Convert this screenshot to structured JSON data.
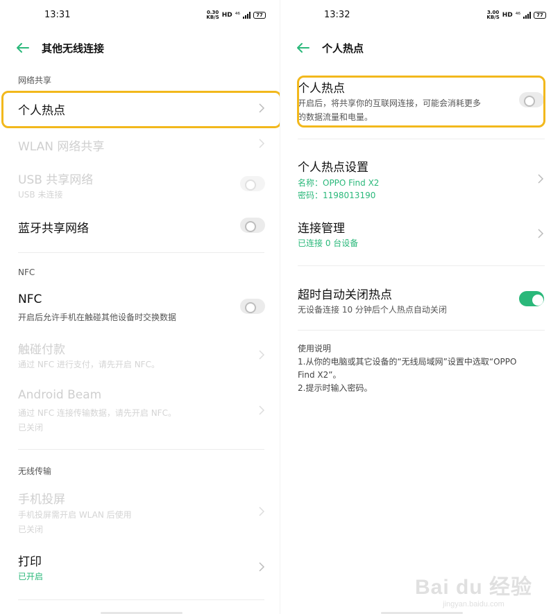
{
  "left": {
    "status": {
      "time": "13:31",
      "speed_value": "0.30",
      "speed_unit": "KB/S",
      "hd": "HD",
      "net": "⁴⁶",
      "battery": "77"
    },
    "header": {
      "title": "其他无线连接"
    },
    "sections": {
      "network_share": "网络共享",
      "nfc": "NFC",
      "wireless_transfer": "无线传输"
    },
    "items": {
      "hotspot": "个人热点",
      "wlan_share": "WLAN 网络共享",
      "usb_share": {
        "title": "USB 共享网络",
        "sub": "USB 未连接"
      },
      "bt_share": "蓝牙共享网络",
      "nfc": {
        "title": "NFC",
        "sub": "开启后允许手机在触碰其他设备时交换数据"
      },
      "tap_pay": {
        "title": "触碰付款",
        "sub": "通过 NFC 进行支付，请先开启 NFC。"
      },
      "android_beam": {
        "title": "Android Beam",
        "sub1": "通过 NFC 连接传输数据，请先开启 NFC。",
        "sub2": "已关闭"
      },
      "screen_cast": {
        "title": "手机投屏",
        "sub1": "手机投屏需开启 WLAN 后使用",
        "sub2": "已关闭"
      },
      "print": {
        "title": "打印",
        "sub": "已开启"
      }
    }
  },
  "right": {
    "status": {
      "time": "13:32",
      "speed_value": "3.00",
      "speed_unit": "KB/S",
      "hd": "HD",
      "net": "⁴⁶",
      "battery": "77"
    },
    "header": {
      "title": "个人热点"
    },
    "hotspot": {
      "title": "个人热点",
      "sub1": "开启后，将共享你的互联网连接，可能会消耗更多",
      "sub2": "的数据流量和电量。"
    },
    "settings": {
      "title": "个人热点设置",
      "name": "名称：OPPO Find X2",
      "password": "密码：1198013190"
    },
    "conn_mgmt": {
      "title": "连接管理",
      "sub": "已连接 0 台设备"
    },
    "auto_off": {
      "title": "超时自动关闭热点",
      "sub": "无设备连接 10 分钟后个人热点自动关闭"
    },
    "usage": {
      "title": "使用说明",
      "line1": "1.从你的电脑或其它设备的“无线局域网”设置中选取“OPPO",
      "line2": "Find X2”。",
      "line3": "2.提示时输入密码。"
    }
  },
  "watermark": {
    "brand": "Bai du 经验",
    "url": "jingyan.baidu.com"
  },
  "colors": {
    "accent_green": "#2ab87a",
    "highlight": "#f2b81c"
  }
}
